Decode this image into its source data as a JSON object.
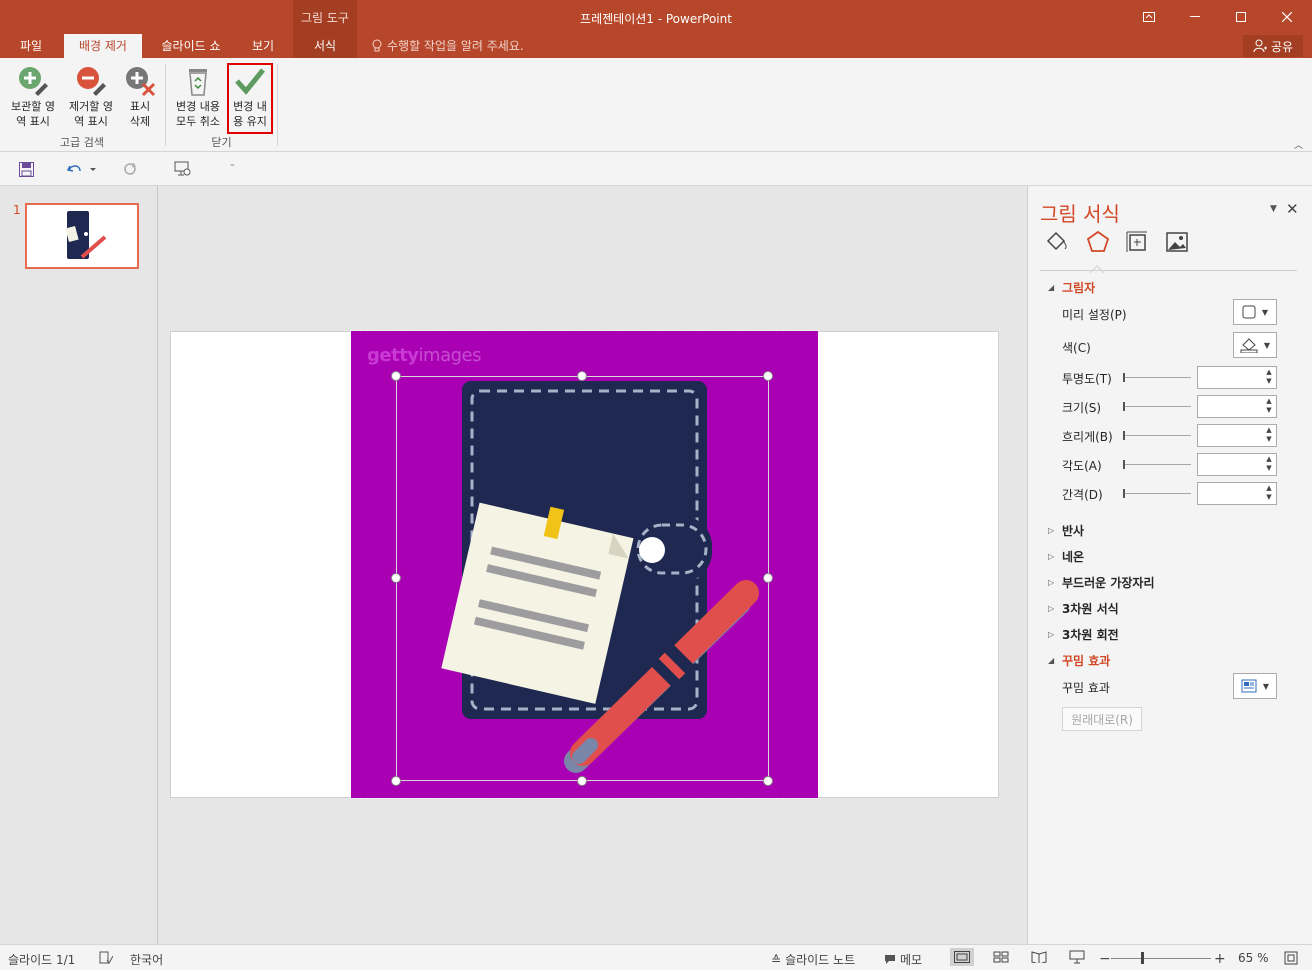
{
  "window": {
    "title": "프레젠테이션1 - PowerPoint",
    "contextual_group": "그림 도구",
    "share": "공유"
  },
  "tabs": [
    {
      "label": "파일",
      "active": false
    },
    {
      "label": "배경 제거",
      "active": true
    },
    {
      "label": "슬라이드 쇼",
      "active": false
    },
    {
      "label": "보기",
      "active": false
    },
    {
      "label": "서식",
      "active": false
    }
  ],
  "tell_me": "수행할 작업을 알려 주세요.",
  "ribbon": {
    "mark_keep": [
      "보관할 영",
      "역 표시"
    ],
    "mark_remove": [
      "제거할 영",
      "역 표시"
    ],
    "delete_mark": [
      "표시",
      "삭제"
    ],
    "discard_all": [
      "변경 내용",
      "모두 취소"
    ],
    "keep_changes": [
      "변경 내",
      "용 유지"
    ],
    "group_refine": "고급 검색",
    "group_close": "닫기"
  },
  "thumbnail": {
    "number": "1"
  },
  "slide": {
    "watermark_bold": "getty",
    "watermark_light": "images"
  },
  "format_pane": {
    "title": "그림 서식",
    "shadow": {
      "heading": "그림자",
      "preset": "미리 설정(P)",
      "color": "색(C)",
      "transparency": "투명도(T)",
      "size": "크기(S)",
      "blur": "흐리게(B)",
      "angle": "각도(A)",
      "distance": "간격(D)"
    },
    "sections": [
      "반사",
      "네온",
      "부드러운 가장자리",
      "3차원 서식",
      "3차원 회전"
    ],
    "artistic": {
      "heading": "꾸밈 효과",
      "label": "꾸밈 효과",
      "reset": "원래대로(R)"
    }
  },
  "statusbar": {
    "slide_info": "슬라이드 1/1",
    "language": "한국어",
    "notes": "슬라이드 노트",
    "comments": "메모",
    "zoom": "65 %",
    "zoom_level": 0.65
  },
  "colors": {
    "accent": "#b7472a",
    "picture_bg": "#aa00b4",
    "highlight": "#e00000"
  }
}
